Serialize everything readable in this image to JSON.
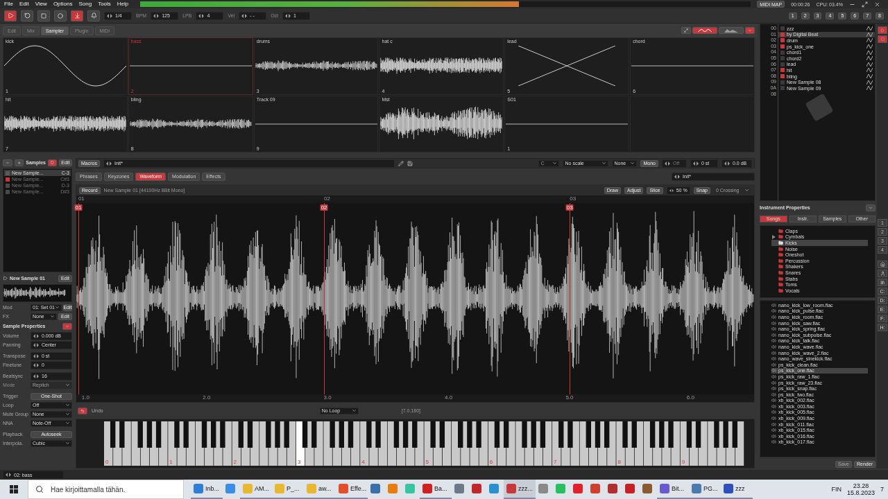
{
  "menu": [
    "File",
    "Edit",
    "View",
    "Options",
    "Song",
    "Tools",
    "Help"
  ],
  "meter": {
    "level": 0.62
  },
  "status": {
    "midi_map": "MIDI MAP",
    "time": "00:00:26",
    "cpu": "CPU: 03.4%"
  },
  "transport": {
    "playing": true,
    "edit_mode": true,
    "fields": [
      {
        "value": "1/4"
      },
      {
        "label": "BPM",
        "value": "125"
      },
      {
        "label": "LPB",
        "value": "4"
      },
      {
        "label": "Vel",
        "value": "- -"
      },
      {
        "label": "Oct",
        "value": "1"
      }
    ]
  },
  "track_buttons": [
    "1",
    "2",
    "3",
    "4",
    "5",
    "6",
    "7",
    "8"
  ],
  "view_tabs": [
    {
      "label": "Edit",
      "selected": false
    },
    {
      "label": "Mix",
      "selected": false
    },
    {
      "label": "Sampler",
      "selected": true
    },
    {
      "label": "Plugin",
      "selected": false
    },
    {
      "label": "MIDI",
      "selected": false
    }
  ],
  "slots": [
    {
      "name": "kick",
      "number": "1",
      "kind": "sine",
      "selected": false
    },
    {
      "name": "bass",
      "number": "2",
      "kind": "flat",
      "selected": true
    },
    {
      "name": "drums",
      "number": "3",
      "kind": "low",
      "selected": false
    },
    {
      "name": "hat c",
      "number": "4",
      "kind": "noise",
      "selected": false
    },
    {
      "name": "lead",
      "number": "5",
      "kind": "cross",
      "selected": false
    },
    {
      "name": "chord",
      "number": "6",
      "kind": "flat",
      "selected": false
    },
    {
      "name": "hit",
      "number": "7",
      "kind": "noise",
      "selected": false
    },
    {
      "name": "bling",
      "number": "8",
      "kind": "low",
      "selected": false
    },
    {
      "name": "Track 09",
      "number": "9",
      "kind": "flat",
      "selected": false
    },
    {
      "name": "Mst",
      "kind": "big",
      "selected": false
    },
    {
      "name": "S01",
      "number": "1",
      "kind": "flat",
      "selected": false
    },
    {
      "kind": "empty",
      "selected": false
    }
  ],
  "samples_panel": {
    "title": "Samples",
    "edit": "Edit",
    "items": [
      {
        "name": "New Sample...",
        "note": "C-3",
        "selected": true,
        "color": "#5a5a5a"
      },
      {
        "name": "New Sample...",
        "note": "C#3",
        "selected": false,
        "color": "#c8373b"
      },
      {
        "name": "New Sample...",
        "note": "D-3",
        "selected": false,
        "color": "#4a4a4a"
      },
      {
        "name": "New Sample...",
        "note": "D#3",
        "selected": false,
        "color": "#4a4a4a"
      }
    ]
  },
  "current_sample": {
    "name": "New Sample 01",
    "edit": "Edit"
  },
  "routing": [
    {
      "label": "Mod",
      "value": "01: Set 01",
      "edit": "Edit"
    },
    {
      "label": "FX",
      "value": "None",
      "edit": "Edit"
    }
  ],
  "sample_properties": {
    "title": "Sample Properties",
    "rows": [
      {
        "kind": "spin",
        "label": "Volume",
        "value": "0.000 dB",
        "disabled": false
      },
      {
        "kind": "spin",
        "label": "Panning",
        "value": "Center",
        "disabled": false
      },
      {
        "kind": "spin",
        "label": "Transpose",
        "value": "0 st",
        "disabled": false
      },
      {
        "kind": "spin",
        "label": "Finetune",
        "value": "0",
        "disabled": false
      },
      {
        "kind": "spin",
        "label": "Beatsync",
        "value": "16",
        "disabled": false
      },
      {
        "kind": "dropdown",
        "label": "Mode",
        "value": "Repitch",
        "disabled": true
      },
      {
        "kind": "button",
        "label": "Trigger",
        "value": "One-Shot",
        "disabled": false
      },
      {
        "kind": "dropdown",
        "label": "Loop",
        "value": "Off",
        "disabled": false
      },
      {
        "kind": "dropdown",
        "label": "Mute Group",
        "value": "None",
        "disabled": false
      },
      {
        "kind": "dropdown",
        "label": "NNA",
        "value": "Note-Off",
        "disabled": false
      },
      {
        "kind": "button",
        "label": "Playback",
        "value": "Autoseek",
        "disabled": false
      },
      {
        "kind": "dropdown",
        "label": "Interpola.",
        "value": "Cubic",
        "disabled": false
      }
    ]
  },
  "instrument_selector": "02: bass",
  "macros": {
    "label": "Macros",
    "preset": "Init*",
    "key": "C",
    "scale": "No scale",
    "chord": "None",
    "mono": "Mono",
    "glide": "Off",
    "transpose": "0 st",
    "volume": "0.0 dB"
  },
  "editor_tabs": [
    {
      "label": "Phrases",
      "selected": false
    },
    {
      "label": "Keyzones",
      "selected": false
    },
    {
      "label": "Waveform",
      "selected": true
    },
    {
      "label": "Modulation",
      "selected": false
    },
    {
      "label": "Effects",
      "selected": false
    }
  ],
  "editor_preset": "Init*",
  "waveform_editor": {
    "record": "Record",
    "info": "New Sample 01 [44100Hz 8Bit Mono]",
    "draw": "Draw",
    "adjust": "Adjust",
    "slice": "Slice",
    "zoom": "50 %",
    "snap": "Snap",
    "crossing": "0 Crossing",
    "ruler": [
      "01",
      "02",
      "03"
    ],
    "slice_markers": [
      "01",
      "02",
      "03"
    ],
    "time_ticks": [
      "1.0",
      "2.0",
      "3.0",
      "4.0",
      "5.0",
      "6.0"
    ]
  },
  "editor_toolbar": {
    "undo": "Undo",
    "undo_checked": true,
    "loop_mode": "No Loop",
    "position": "[7.0.180]"
  },
  "keyboard": {
    "octaves": [
      {
        "label": "0",
        "pressed": false
      },
      {
        "label": "1",
        "pressed": false
      },
      {
        "label": "2",
        "pressed": false
      },
      {
        "label": "3",
        "pressed": true
      },
      {
        "label": "4",
        "pressed": false
      },
      {
        "label": "5",
        "pressed": false
      },
      {
        "label": "6",
        "pressed": false
      },
      {
        "label": "7",
        "pressed": false
      },
      {
        "label": "8",
        "pressed": false
      },
      {
        "label": "9",
        "pressed": false
      }
    ]
  },
  "instruments": [
    {
      "index": "00",
      "name": "zzz",
      "selected": false,
      "color": "#3a3a3a"
    },
    {
      "index": "01",
      "name": "by Digital Beat",
      "selected": true,
      "color": "#c8373b"
    },
    {
      "index": "02",
      "name": "drum",
      "selected": false,
      "color": "#c8373b"
    },
    {
      "index": "03",
      "name": "ps_kick_one",
      "selected": false,
      "color": "#c8373b"
    },
    {
      "index": "04",
      "name": "chord1",
      "selected": false,
      "color": "#3a3a3a"
    },
    {
      "index": "05",
      "name": "chord2",
      "selected": false,
      "color": "#3a3a3a"
    },
    {
      "index": "06",
      "name": "lead",
      "selected": false,
      "color": "#3a3a3a"
    },
    {
      "index": "07",
      "name": "hit",
      "selected": false,
      "color": "#c8373b"
    },
    {
      "index": "08",
      "name": "bling",
      "selected": false,
      "color": "#c8373b"
    },
    {
      "index": "09",
      "name": "New Sample 08",
      "selected": false,
      "color": "#3a3a3a"
    },
    {
      "index": "0A",
      "name": "New Sample 09",
      "selected": false,
      "color": "#3a3a3a"
    },
    {
      "index": "08",
      "selected": false
    }
  ],
  "instrument_properties": "Instrument Properties",
  "browser": {
    "tabs": [
      {
        "label": "Songs",
        "selected": true
      },
      {
        "label": "Instr.",
        "selected": false
      },
      {
        "label": "Samples",
        "selected": false
      },
      {
        "label": "Other",
        "selected": false
      }
    ],
    "folders": [
      {
        "name": "Claps",
        "selected": false,
        "has_children": false
      },
      {
        "name": "Cymbals",
        "selected": false,
        "has_children": true
      },
      {
        "name": "Kicks",
        "selected": true,
        "has_children": false
      },
      {
        "name": "Noise",
        "selected": false,
        "has_children": false
      },
      {
        "name": "Oneshot",
        "selected": false,
        "has_children": false
      },
      {
        "name": "Percussion",
        "selected": false,
        "has_children": false
      },
      {
        "name": "Shakers",
        "selected": false,
        "has_children": false
      },
      {
        "name": "Snares",
        "selected": false,
        "has_children": false
      },
      {
        "name": "Stabs",
        "selected": false,
        "has_children": false
      },
      {
        "name": "Toms",
        "selected": false,
        "has_children": false
      },
      {
        "name": "Vocals",
        "selected": false,
        "has_children": false
      }
    ],
    "files": [
      {
        "name": "nano_kick_low_room.flac",
        "selected": false
      },
      {
        "name": "nano_kick_pulse.flac",
        "selected": false
      },
      {
        "name": "nano_kick_room.flac",
        "selected": false
      },
      {
        "name": "nano_kick_saw.flac",
        "selected": false
      },
      {
        "name": "nano_kick_spring.flac",
        "selected": false
      },
      {
        "name": "nano_kick_subpulse.flac",
        "selected": false
      },
      {
        "name": "nano_kick_talk.flac",
        "selected": false
      },
      {
        "name": "nano_kick_wave.flac",
        "selected": false
      },
      {
        "name": "nano_kick_wave_2.flac",
        "selected": false
      },
      {
        "name": "nano_wave_sinekick.flac",
        "selected": false
      },
      {
        "name": "ps_kick_clean.flac",
        "selected": false
      },
      {
        "name": "ps_kick_one.flac",
        "selected": true
      },
      {
        "name": "ps_kick_raw_1.flac",
        "selected": false
      },
      {
        "name": "ps_kick_raw_23.flac",
        "selected": false
      },
      {
        "name": "ps_kick_snap.flac",
        "selected": false
      },
      {
        "name": "ps_kick_two.flac",
        "selected": false
      },
      {
        "name": "xb_kick_002.flac",
        "selected": false
      },
      {
        "name": "xb_kick_003.flac",
        "selected": false
      },
      {
        "name": "xb_kick_005.flac",
        "selected": false
      },
      {
        "name": "xb_kick_009.flac",
        "selected": false
      },
      {
        "name": "xb_kick_011.flac",
        "selected": false
      },
      {
        "name": "xb_kick_015.flac",
        "selected": false
      },
      {
        "name": "xb_kick_016.flac",
        "selected": false
      },
      {
        "name": "xb_kick_017.flac",
        "selected": false
      }
    ],
    "save": "Save",
    "render": "Render"
  },
  "drives": {
    "numbers": [
      "1",
      "2",
      "3",
      "4"
    ],
    "letters": [
      "C:",
      "D:",
      "E:",
      "F:",
      "H:"
    ]
  },
  "taskbar": {
    "search_placeholder": "Hae kirjoittamalla tähän.",
    "apps": [
      {
        "kind": "labeled",
        "label": "Inb...",
        "color": "#2f7fd8",
        "selected": false
      },
      {
        "kind": "icon",
        "color": "#3a8ee6",
        "selected": false
      },
      {
        "kind": "labeled",
        "label": "AM...",
        "color": "#e8b830",
        "selected": false
      },
      {
        "kind": "labeled",
        "label": "P_...",
        "color": "#e8b830",
        "selected": false
      },
      {
        "kind": "labeled",
        "label": "aw...",
        "color": "#e8b830",
        "selected": false
      },
      {
        "kind": "labeled",
        "label": "Effe...",
        "color": "#e0502a",
        "selected": false
      },
      {
        "kind": "icon",
        "color": "#3b6fa8",
        "selected": false
      },
      {
        "kind": "icon",
        "color": "#e87d0d",
        "selected": false
      },
      {
        "kind": "icon",
        "color": "#36c5a0",
        "selected": false
      },
      {
        "kind": "labeled",
        "label": "Ba...",
        "color": "#d02020",
        "selected": false
      },
      {
        "kind": "icon",
        "color": "#6c7a89",
        "selected": false
      },
      {
        "kind": "icon",
        "color": "#c0282d",
        "selected": false
      },
      {
        "kind": "icon",
        "color": "#2a90d0",
        "selected": false
      },
      {
        "kind": "labeled",
        "label": "zzz...",
        "color": "#c8373b",
        "selected": true
      },
      {
        "kind": "icon",
        "color": "#8a8a8a",
        "selected": false
      },
      {
        "kind": "icon",
        "color": "#25c060",
        "selected": false
      },
      {
        "kind": "icon",
        "color": "#e0202a",
        "selected": false
      },
      {
        "kind": "icon",
        "color": "#d0402a",
        "selected": false
      },
      {
        "kind": "icon",
        "color": "#b03030",
        "selected": false
      },
      {
        "kind": "icon",
        "color": "#c82020",
        "selected": false
      },
      {
        "kind": "icon",
        "color": "#8a5a30",
        "selected": false
      },
      {
        "kind": "labeled",
        "label": "Bit...",
        "color": "#6a5ad0",
        "selected": false
      },
      {
        "kind": "labeled",
        "label": "PG...",
        "color": "#4a7ab0",
        "selected": false
      },
      {
        "kind": "labeled",
        "label": "zzz",
        "color": "#3050c0",
        "selected": false
      }
    ],
    "language": "FIN",
    "time": "23.28",
    "date": "15.8.2023",
    "notifications": "7"
  }
}
